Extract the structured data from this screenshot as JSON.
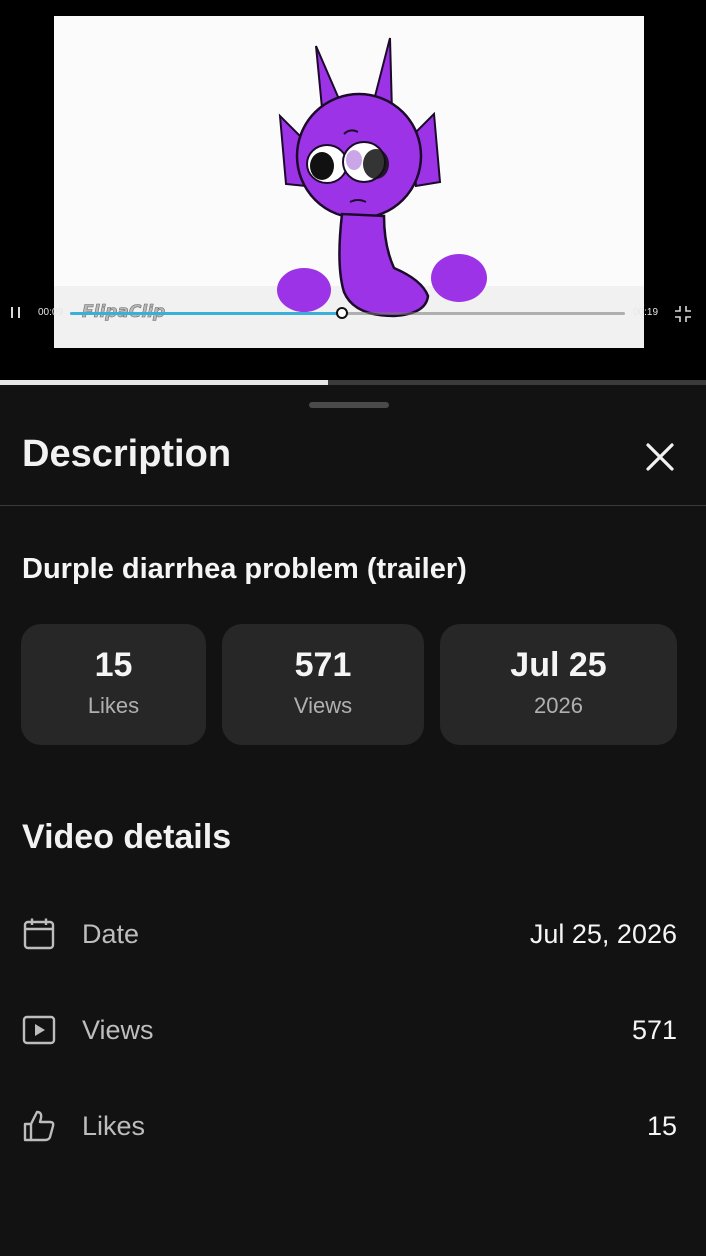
{
  "player": {
    "current_time": "00:09",
    "total_time": "00:19",
    "progress": 0.49,
    "watermark": "FlipaClip",
    "progress_color": "#3ab0d8",
    "character_color": "#9d33e6"
  },
  "page_progress": 0.465,
  "sheet": {
    "title": "Description"
  },
  "video": {
    "title": "Durple diarrhea problem (trailer)"
  },
  "stats": [
    {
      "value": "15",
      "label": "Likes"
    },
    {
      "value": "571",
      "label": "Views"
    },
    {
      "value": "Jul 25",
      "label": "2026"
    }
  ],
  "details": {
    "title": "Video details",
    "rows": [
      {
        "icon": "calendar-icon",
        "label": "Date",
        "value": "Jul 25, 2026"
      },
      {
        "icon": "play-square-icon",
        "label": "Views",
        "value": "571"
      },
      {
        "icon": "thumbs-up-icon",
        "label": "Likes",
        "value": "15"
      }
    ]
  }
}
